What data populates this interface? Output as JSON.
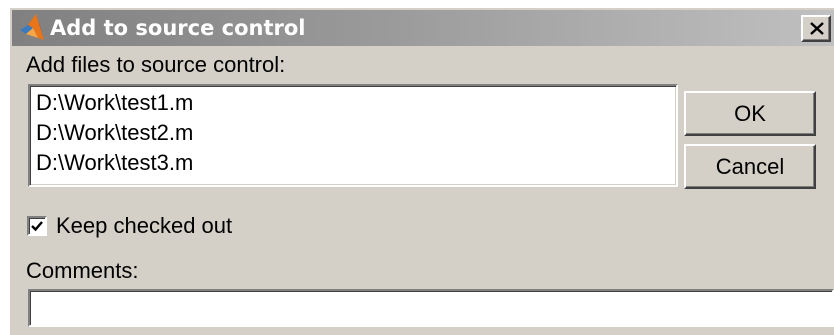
{
  "window": {
    "title": "Add to source control",
    "icon": "matlab-logo-icon",
    "close_icon": "close-icon"
  },
  "files_label": "Add files to source control:",
  "files": [
    "D:\\Work\\test1.m",
    "D:\\Work\\test2.m",
    "D:\\Work\\test3.m"
  ],
  "buttons": {
    "ok": "OK",
    "cancel": "Cancel"
  },
  "keep_checked_out": {
    "label": "Keep checked out",
    "checked": true
  },
  "comments": {
    "label": "Comments:",
    "value": ""
  },
  "colors": {
    "dialog_bg": "#d4d0c8",
    "titlebar_start": "#808080",
    "titlebar_end": "#c0c0c0",
    "title_text": "#ffffff"
  }
}
